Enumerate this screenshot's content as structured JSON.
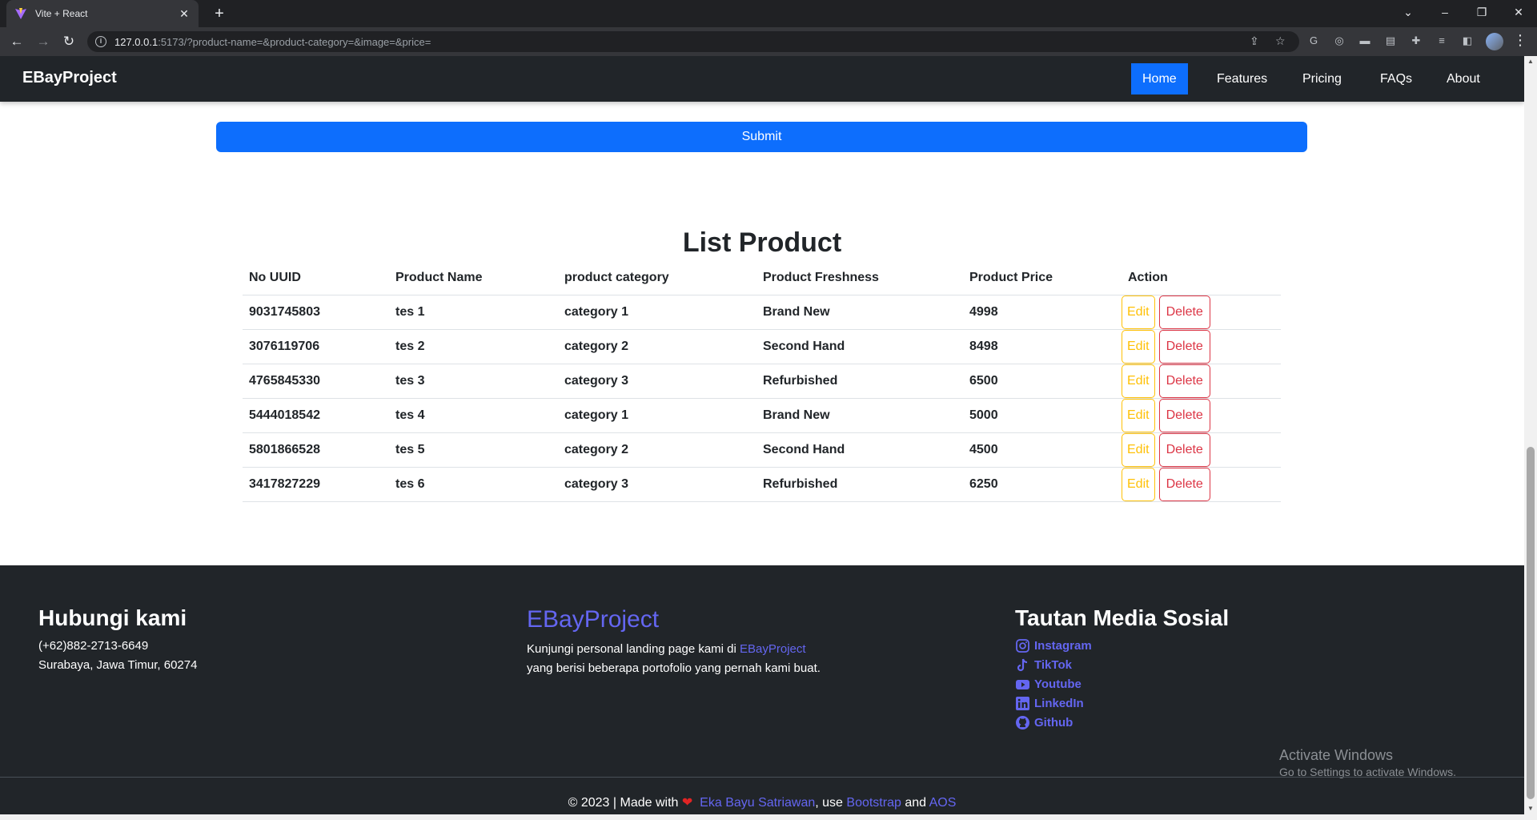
{
  "browser": {
    "tab_title": "Vite + React",
    "url_host": "127.0.0.1",
    "url_rest": ":5173/?product-name=&product-category=&image=&price="
  },
  "navbar": {
    "brand": "EBayProject",
    "links": [
      "Home",
      "Features",
      "Pricing",
      "FAQs",
      "About"
    ],
    "active": "Home"
  },
  "form": {
    "submit_label": "Submit"
  },
  "products": {
    "title": "List Product",
    "headers": [
      "No UUID",
      "Product Name",
      "product category",
      "Product Freshness",
      "Product Price",
      "Action"
    ],
    "rows": [
      {
        "uuid": "9031745803",
        "name": "tes 1",
        "category": "category 1",
        "freshness": "Brand New",
        "price": "4998"
      },
      {
        "uuid": "3076119706",
        "name": "tes 2",
        "category": "category 2",
        "freshness": "Second Hand",
        "price": "8498"
      },
      {
        "uuid": "4765845330",
        "name": "tes 3",
        "category": "category 3",
        "freshness": "Refurbished",
        "price": "6500"
      },
      {
        "uuid": "5444018542",
        "name": "tes 4",
        "category": "category 1",
        "freshness": "Brand New",
        "price": "5000"
      },
      {
        "uuid": "5801866528",
        "name": "tes 5",
        "category": "category 2",
        "freshness": "Second Hand",
        "price": "4500"
      },
      {
        "uuid": "3417827229",
        "name": "tes 6",
        "category": "category 3",
        "freshness": "Refurbished",
        "price": "6250"
      }
    ],
    "edit_label": "Edit",
    "delete_label": "Delete"
  },
  "footer": {
    "contact_title": "Hubungi kami",
    "phone": "(+62)882-2713-6649",
    "address": "Surabaya, Jawa Timur, 60274",
    "brand_title": "EBayProject",
    "desc_prefix": "Kunjungi personal landing page kami di ",
    "desc_link": "EBayProject",
    "desc_line2": "yang berisi beberapa portofolio yang pernah kami buat.",
    "social_title": "Tautan Media Sosial",
    "social": [
      {
        "label": "Instagram",
        "icon": "instagram-icon"
      },
      {
        "label": "TikTok",
        "icon": "tiktok-icon"
      },
      {
        "label": "Youtube",
        "icon": "youtube-icon"
      },
      {
        "label": "LinkedIn",
        "icon": "linkedin-icon"
      },
      {
        "label": "Github",
        "icon": "github-icon"
      }
    ],
    "copy_prefix": "© 2023 | Made with ",
    "copy_author": "Eka Bayu Satriawan",
    "copy_mid": ", use ",
    "copy_bootstrap": "Bootstrap",
    "copy_and": " and ",
    "copy_aos": "AOS"
  },
  "os_watermark": {
    "line1": "Activate Windows",
    "line2": "Go to Settings to activate Windows."
  },
  "colors": {
    "primary": "#0d6efd",
    "warning": "#ffc107",
    "danger": "#dc3545",
    "dark": "#212529",
    "brand": "#6466f1"
  }
}
